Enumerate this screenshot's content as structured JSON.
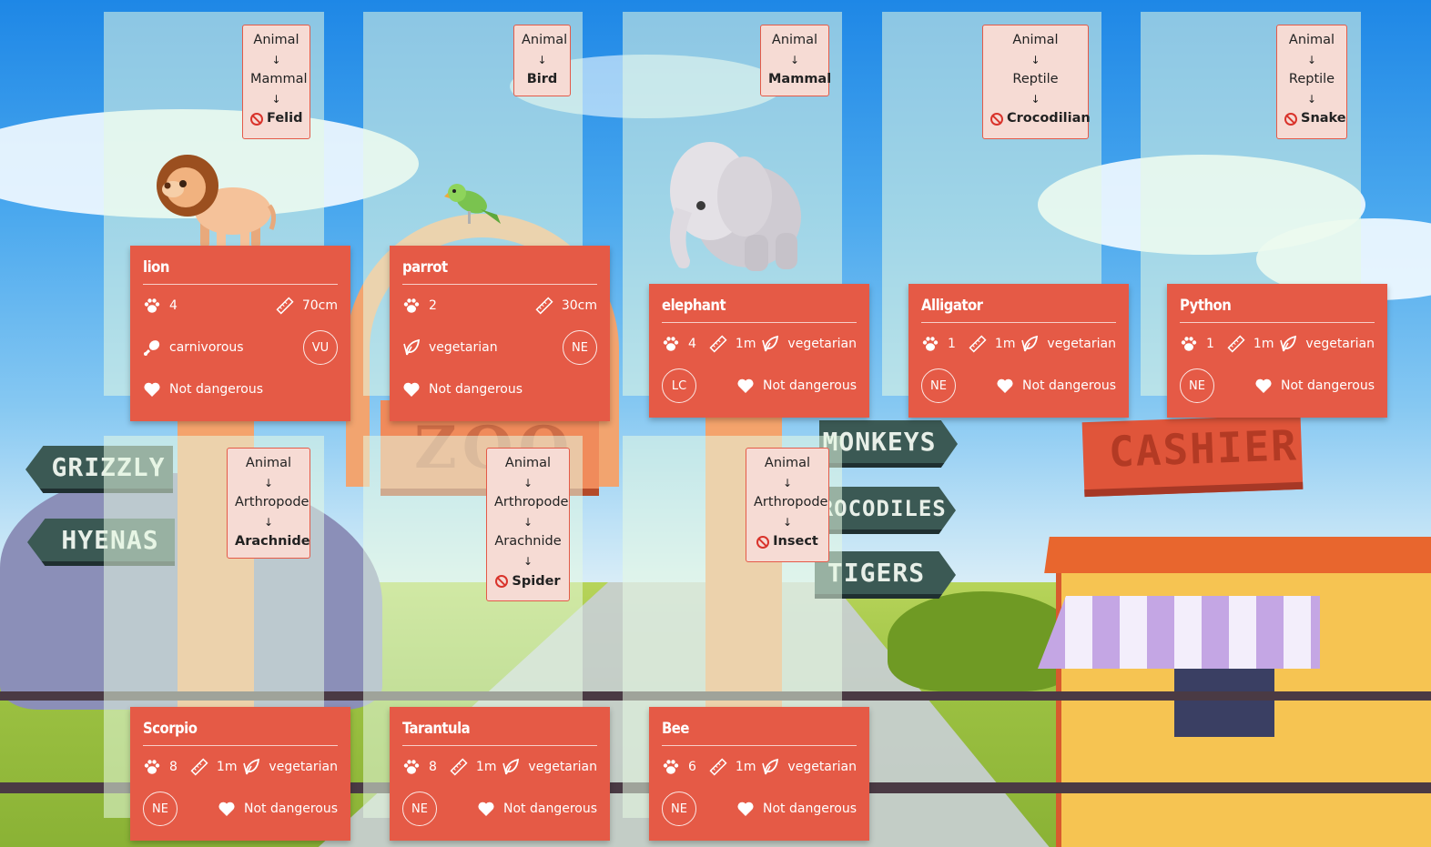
{
  "signs": {
    "grizzly": "GRIZZLY",
    "hyenas": "HYENAS",
    "monkeys": "MONKEYS",
    "crocodiles": "CROCODILES",
    "tigers": "TIGERS",
    "cashier": "CASHIER",
    "zoo": "ZOO"
  },
  "taxonomy": {
    "lion": {
      "items": [
        "Animal",
        "Mammal"
      ],
      "leaf": "Felid",
      "banned": true
    },
    "parrot": {
      "items": [
        "Animal"
      ],
      "leaf": "Bird",
      "banned": false
    },
    "elephant": {
      "items": [
        "Animal"
      ],
      "leaf": "Mammal",
      "banned": false
    },
    "alligator": {
      "items": [
        "Animal",
        "Reptile"
      ],
      "leaf": "Crocodilian",
      "banned": true
    },
    "python": {
      "items": [
        "Animal",
        "Reptile"
      ],
      "leaf": "Snake",
      "banned": true
    },
    "scorpio": {
      "items": [
        "Animal",
        "Arthropode"
      ],
      "leaf": "Arachnide",
      "banned": false
    },
    "tarantula": {
      "items": [
        "Animal",
        "Arthropode",
        "Arachnide"
      ],
      "leaf": "Spider",
      "banned": true
    },
    "bee": {
      "items": [
        "Animal",
        "Arthropode"
      ],
      "leaf": "Insect",
      "banned": true
    },
    "arrow": "↓"
  },
  "cards": {
    "lion": {
      "name": "lion",
      "legs": "4",
      "size": "70cm",
      "diet": "carnivorous",
      "status": "VU",
      "danger": "Not dangerous"
    },
    "parrot": {
      "name": "parrot",
      "legs": "2",
      "size": "30cm",
      "diet": "vegetarian",
      "status": "NE",
      "danger": "Not dangerous"
    },
    "elephant": {
      "name": "elephant",
      "legs": "4",
      "size": "1m",
      "diet": "vegetarian",
      "status": "LC",
      "danger": "Not dangerous"
    },
    "alligator": {
      "name": "Alligator",
      "legs": "1",
      "size": "1m",
      "diet": "vegetarian",
      "status": "NE",
      "danger": "Not dangerous"
    },
    "python": {
      "name": "Python",
      "legs": "1",
      "size": "1m",
      "diet": "vegetarian",
      "status": "NE",
      "danger": "Not dangerous"
    },
    "scorpio": {
      "name": "Scorpio",
      "legs": "8",
      "size": "1m",
      "diet": "vegetarian",
      "status": "NE",
      "danger": "Not dangerous"
    },
    "tarantula": {
      "name": "Tarantula",
      "legs": "8",
      "size": "1m",
      "diet": "vegetarian",
      "status": "NE",
      "danger": "Not dangerous"
    },
    "bee": {
      "name": "Bee",
      "legs": "6",
      "size": "1m",
      "diet": "vegetarian",
      "status": "NE",
      "danger": "Not dangerous"
    }
  },
  "icons": {
    "legs": "paw-icon",
    "size": "ruler-icon",
    "diet_meat": "drumstick-icon",
    "diet_veg": "leaf-icon",
    "danger": "heart-icon",
    "banned": "ban-icon"
  },
  "colors": {
    "card": "#e55a46",
    "taxonomy_bg": "#f6dbd4",
    "taxonomy_border": "#e45a48"
  }
}
